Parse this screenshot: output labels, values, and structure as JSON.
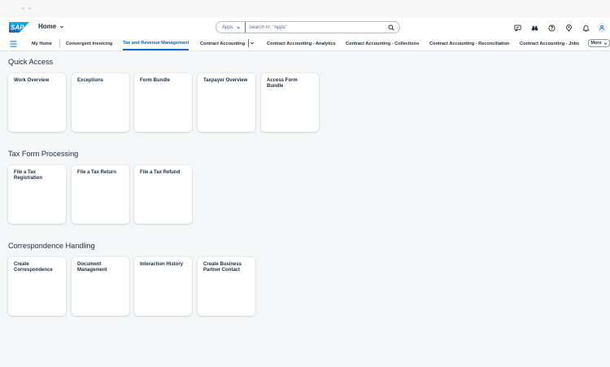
{
  "shell": {
    "logo_text": "SAP",
    "home_title": "Home",
    "search": {
      "scope": "Apps",
      "placeholder": "Search In: \"Apps\""
    },
    "icons": [
      "feedback-icon",
      "binoculars-icon",
      "help-icon",
      "location-icon",
      "notification-bell-icon",
      "user-avatar-icon"
    ]
  },
  "nav": {
    "tabs": [
      {
        "label": "My Home",
        "active": false
      },
      {
        "label": "Convergent Invoicing",
        "active": false
      },
      {
        "label": "Tax and Revenue Management",
        "active": true
      },
      {
        "label": "Contract Accounting",
        "active": false
      },
      {
        "label": "Contract Accounting - Analytics",
        "active": false
      },
      {
        "label": "Contract Accounting - Collections",
        "active": false
      },
      {
        "label": "Contract Accounting - Reconciliation",
        "active": false
      },
      {
        "label": "Contract Accounting - Jobs",
        "active": false
      }
    ],
    "more_label": "More"
  },
  "sections": [
    {
      "title": "Quick Access",
      "tiles": [
        "Work Overview",
        "Exceptions",
        "Form Bundle",
        "Taxpayer Overview",
        "Access Form Bundle"
      ]
    },
    {
      "title": "Tax Form Processing",
      "tiles": [
        "File a Tax Registration",
        "File a Tax Return",
        "File a Tax Refund"
      ]
    },
    {
      "title": "Correspondence Handling",
      "tiles": [
        "Create Correspondence",
        "Document Management",
        "Interaction History",
        "Create Business Partner Contact"
      ]
    }
  ],
  "colors": {
    "brand_blue": "#0a6ed1",
    "active_tab": "#0064d9",
    "page_bg": "#f5f6f7"
  }
}
